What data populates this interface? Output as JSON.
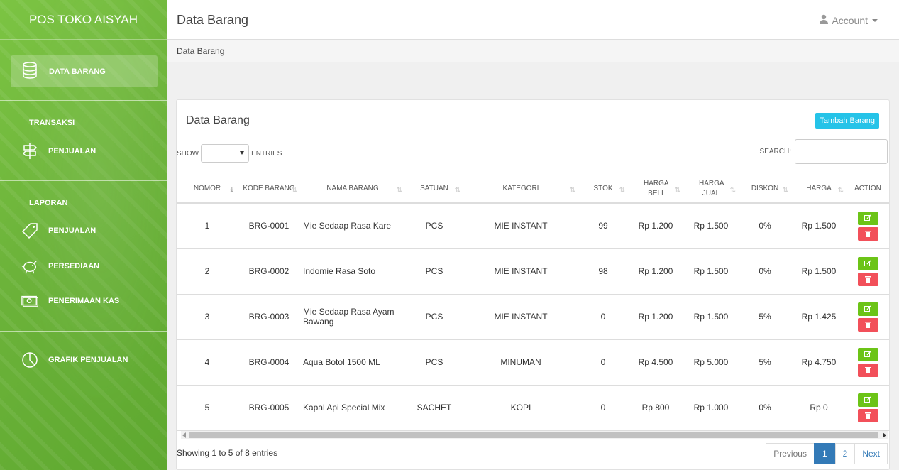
{
  "app": {
    "brand": "POS TOKO AISYAH"
  },
  "sidebar": {
    "active_item": "DATA BARANG",
    "sections": [
      {
        "heading": "TRANSAKSI",
        "items": [
          "PENJUALAN"
        ]
      },
      {
        "heading": "LAPORAN",
        "items": [
          "PENJUALAN",
          "PERSEDIAAN",
          "PENERIMAAN KAS"
        ]
      },
      {
        "heading": "",
        "items": [
          "GRAFIK PENJUALAN"
        ]
      }
    ]
  },
  "header": {
    "title": "Data Barang",
    "account": "Account"
  },
  "breadcrumb": "Data Barang",
  "panel": {
    "title": "Data Barang",
    "add_button": "Tambah Barang",
    "show_label": "SHOW",
    "entries_label": "ENTRIES",
    "search_label": "SEARCH:",
    "search_value": ""
  },
  "table": {
    "headers": [
      "NOMOR",
      "KODE BARANG",
      "NAMA BARANG",
      "SATUAN",
      "KATEGORI",
      "STOK",
      "HARGA BELI",
      "HARGA JUAL",
      "DISKON",
      "HARGA",
      "ACTION"
    ],
    "rows": [
      [
        "1",
        "BRG-0001",
        "Mie Sedaap Rasa Kare",
        "PCS",
        "MIE INSTANT",
        "99",
        "Rp 1.200",
        "Rp 1.500",
        "0%",
        "Rp 1.500"
      ],
      [
        "2",
        "BRG-0002",
        "Indomie Rasa Soto",
        "PCS",
        "MIE INSTANT",
        "98",
        "Rp 1.200",
        "Rp 1.500",
        "0%",
        "Rp 1.500"
      ],
      [
        "3",
        "BRG-0003",
        "Mie Sedaap Rasa Ayam Bawang",
        "PCS",
        "MIE INSTANT",
        "0",
        "Rp 1.200",
        "Rp 1.500",
        "5%",
        "Rp 1.425"
      ],
      [
        "4",
        "BRG-0004",
        "Aqua Botol 1500 ML",
        "PCS",
        "MINUMAN",
        "0",
        "Rp 4.500",
        "Rp 5.000",
        "5%",
        "Rp 4.750"
      ],
      [
        "5",
        "BRG-0005",
        "Kapal Api Special Mix",
        "SACHET",
        "KOPI",
        "0",
        "Rp 800",
        "Rp 1.000",
        "0%",
        "Rp 0"
      ]
    ]
  },
  "footer": {
    "info": "Showing 1 to 5 of 8 entries",
    "pagination": {
      "previous": "Previous",
      "pages": [
        "1",
        "2"
      ],
      "next": "Next"
    }
  },
  "colors": {
    "sidebar": "#6cb33a",
    "edit_button": "#6cc417",
    "delete_button": "#f2505a",
    "add_button": "#25c3e8",
    "page_active": "#337ab7"
  },
  "icons": [
    "database-icon",
    "signpost-icon",
    "tag-icon",
    "piggy-bank-icon",
    "money-icon",
    "pie-chart-icon",
    "user-icon",
    "edit-icon",
    "trash-icon"
  ]
}
